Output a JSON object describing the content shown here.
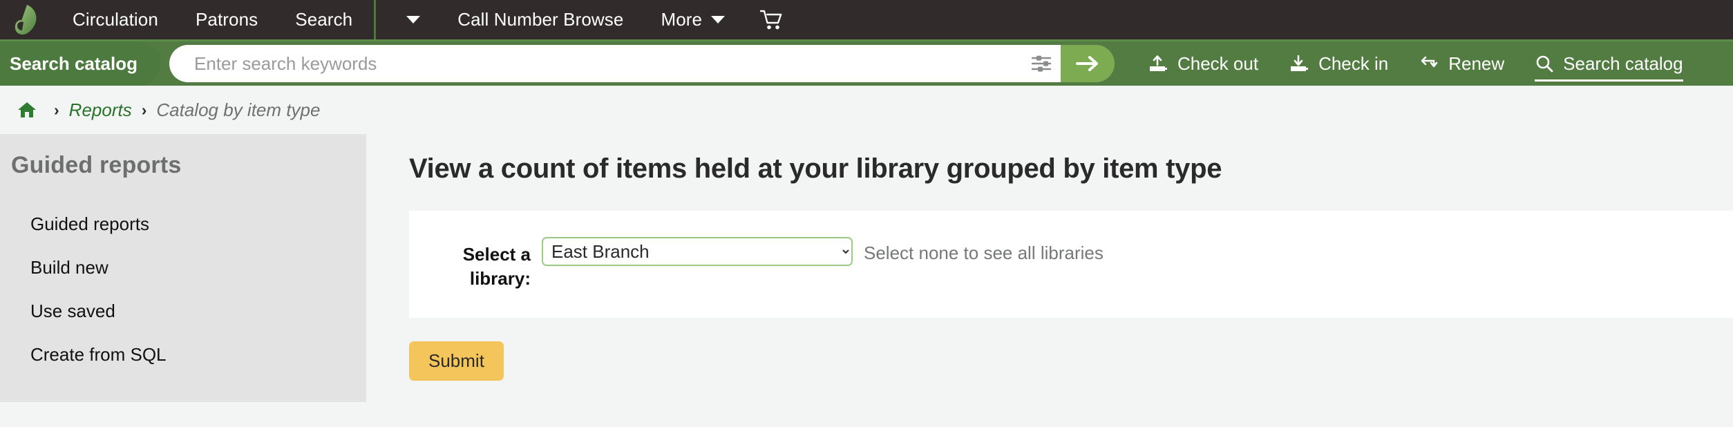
{
  "navbar": {
    "logo_name": "koha-leaf-logo",
    "items": [
      {
        "label": "Circulation",
        "icon": null
      },
      {
        "label": "Patrons",
        "icon": null
      },
      {
        "label": "Search",
        "icon": null
      }
    ],
    "dropdown_toggle_label": "",
    "items_after": [
      {
        "label": "Call Number Browse",
        "icon": null
      },
      {
        "label": "More",
        "icon": "chevron-down-icon"
      }
    ],
    "cart_icon": "shopping-cart-icon"
  },
  "searchbar": {
    "tab_label": "Search catalog",
    "placeholder": "Enter search keywords",
    "value": "",
    "filter_icon": "sliders-icon",
    "submit_icon": "arrow-right-icon",
    "tools": [
      {
        "label": "Check out",
        "icon": "upload-book-icon",
        "active": false
      },
      {
        "label": "Check in",
        "icon": "download-book-icon",
        "active": false
      },
      {
        "label": "Renew",
        "icon": "renew-arrows-icon",
        "active": false
      },
      {
        "label": "Search catalog",
        "icon": "magnifier-icon",
        "active": true
      }
    ]
  },
  "breadcrumb": {
    "home_icon": "home-icon",
    "separator": "›",
    "link": "Reports",
    "current": "Catalog by item type"
  },
  "sidebar": {
    "heading": "Guided reports",
    "items": [
      {
        "label": "Guided reports"
      },
      {
        "label": "Build new"
      },
      {
        "label": "Use saved"
      },
      {
        "label": "Create from SQL"
      }
    ]
  },
  "main": {
    "title": "View a count of items held at your library grouped by item type",
    "form": {
      "library_label": "Select a library:",
      "library_selected": "East Branch",
      "library_options": [
        "East Branch"
      ],
      "hint": "Select none to see all libraries",
      "submit_label": "Submit"
    }
  },
  "colors": {
    "navbar_bg": "#322b2b",
    "navbar_border": "#5c8b49",
    "search_bg": "#537c42",
    "search_go": "#7cab52",
    "sidebar_bg": "#e3e3e3",
    "page_bg": "#f3f4f4",
    "link_green": "#29722b",
    "select_border": "#9ccb87",
    "submit_bg": "#f4c55a"
  }
}
